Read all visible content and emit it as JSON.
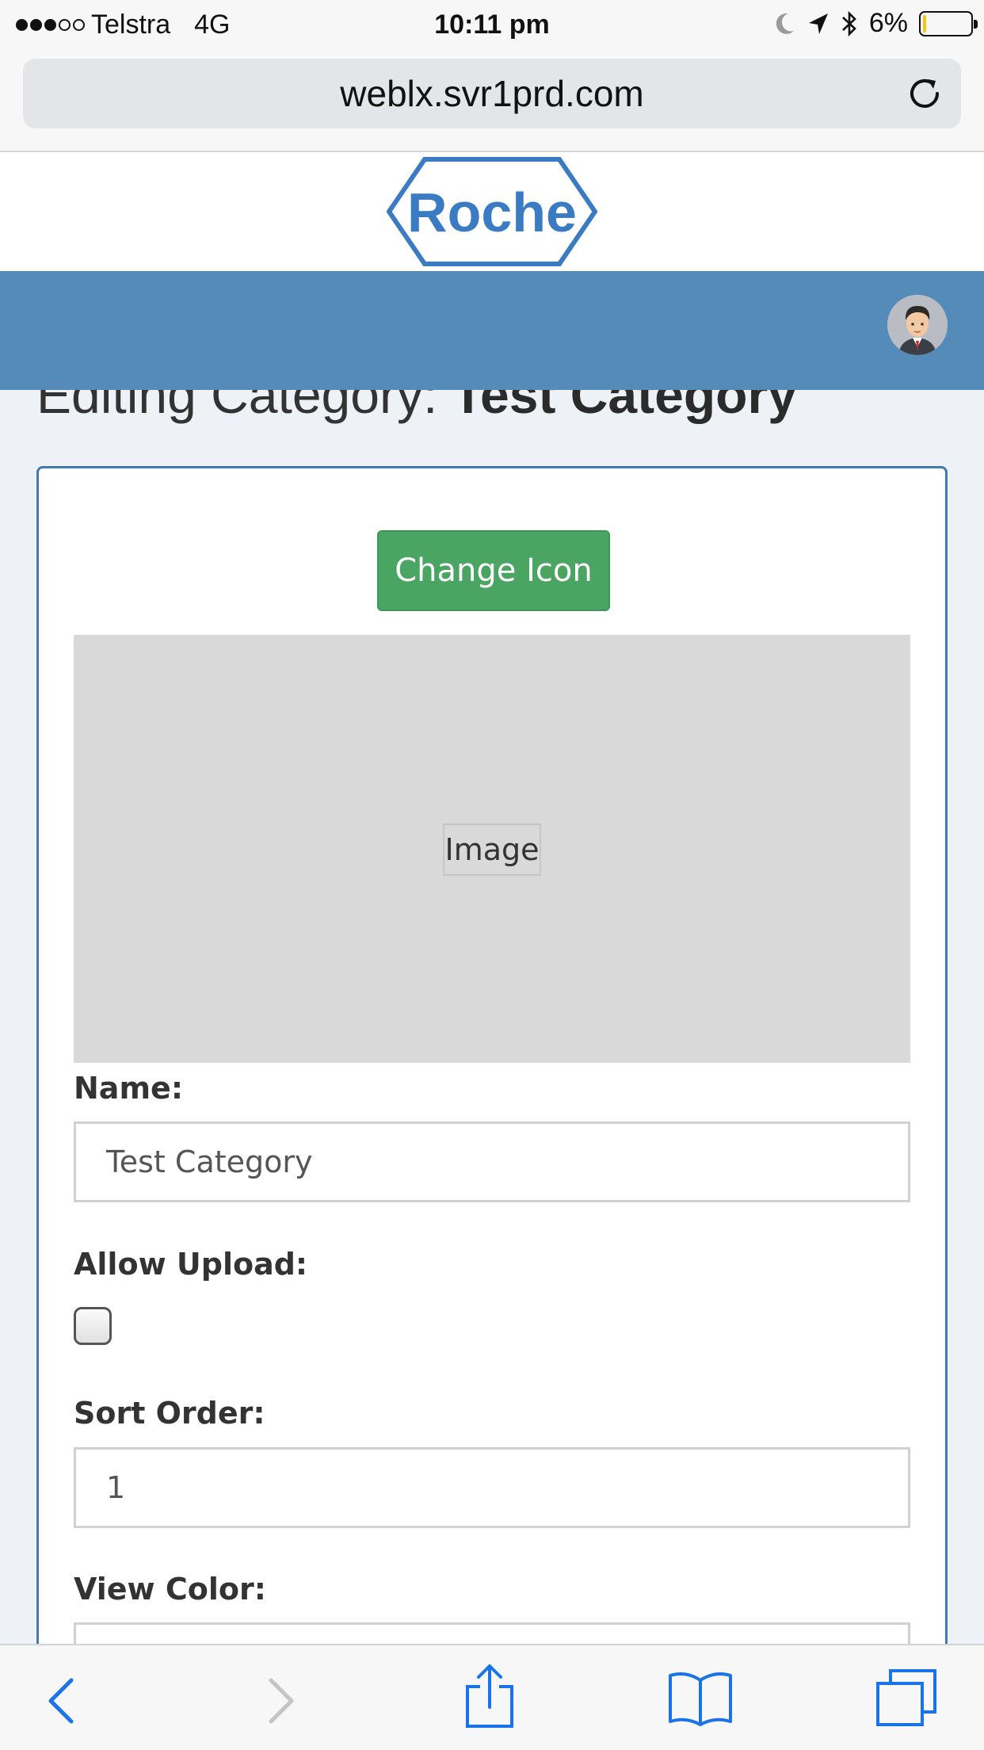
{
  "status_bar": {
    "carrier": "Telstra",
    "network": "4G",
    "time": "10:11 pm",
    "battery": "6%",
    "battery_level": 0.06
  },
  "browser": {
    "url": "weblx.svr1prd.com"
  },
  "header": {
    "logo_text": "Roche"
  },
  "page": {
    "title_prefix": "Editing Category: ",
    "title_name": "Test Category"
  },
  "form": {
    "change_icon_label": "Change Icon",
    "image_placeholder": "Image",
    "name_label": "Name:",
    "name_value": "Test Category",
    "allow_upload_label": "Allow Upload:",
    "allow_upload_checked": false,
    "sort_order_label": "Sort Order:",
    "sort_order_value": "1",
    "view_color_label": "View Color:"
  },
  "colors": {
    "brand_blue": "#548bb8",
    "card_border": "#3f7ab3",
    "button_green": "#4aa563",
    "ios_blue": "#1a73e8"
  },
  "toolbar": {
    "icons": [
      "back-icon",
      "forward-icon",
      "share-icon",
      "bookmarks-icon",
      "tabs-icon"
    ]
  }
}
